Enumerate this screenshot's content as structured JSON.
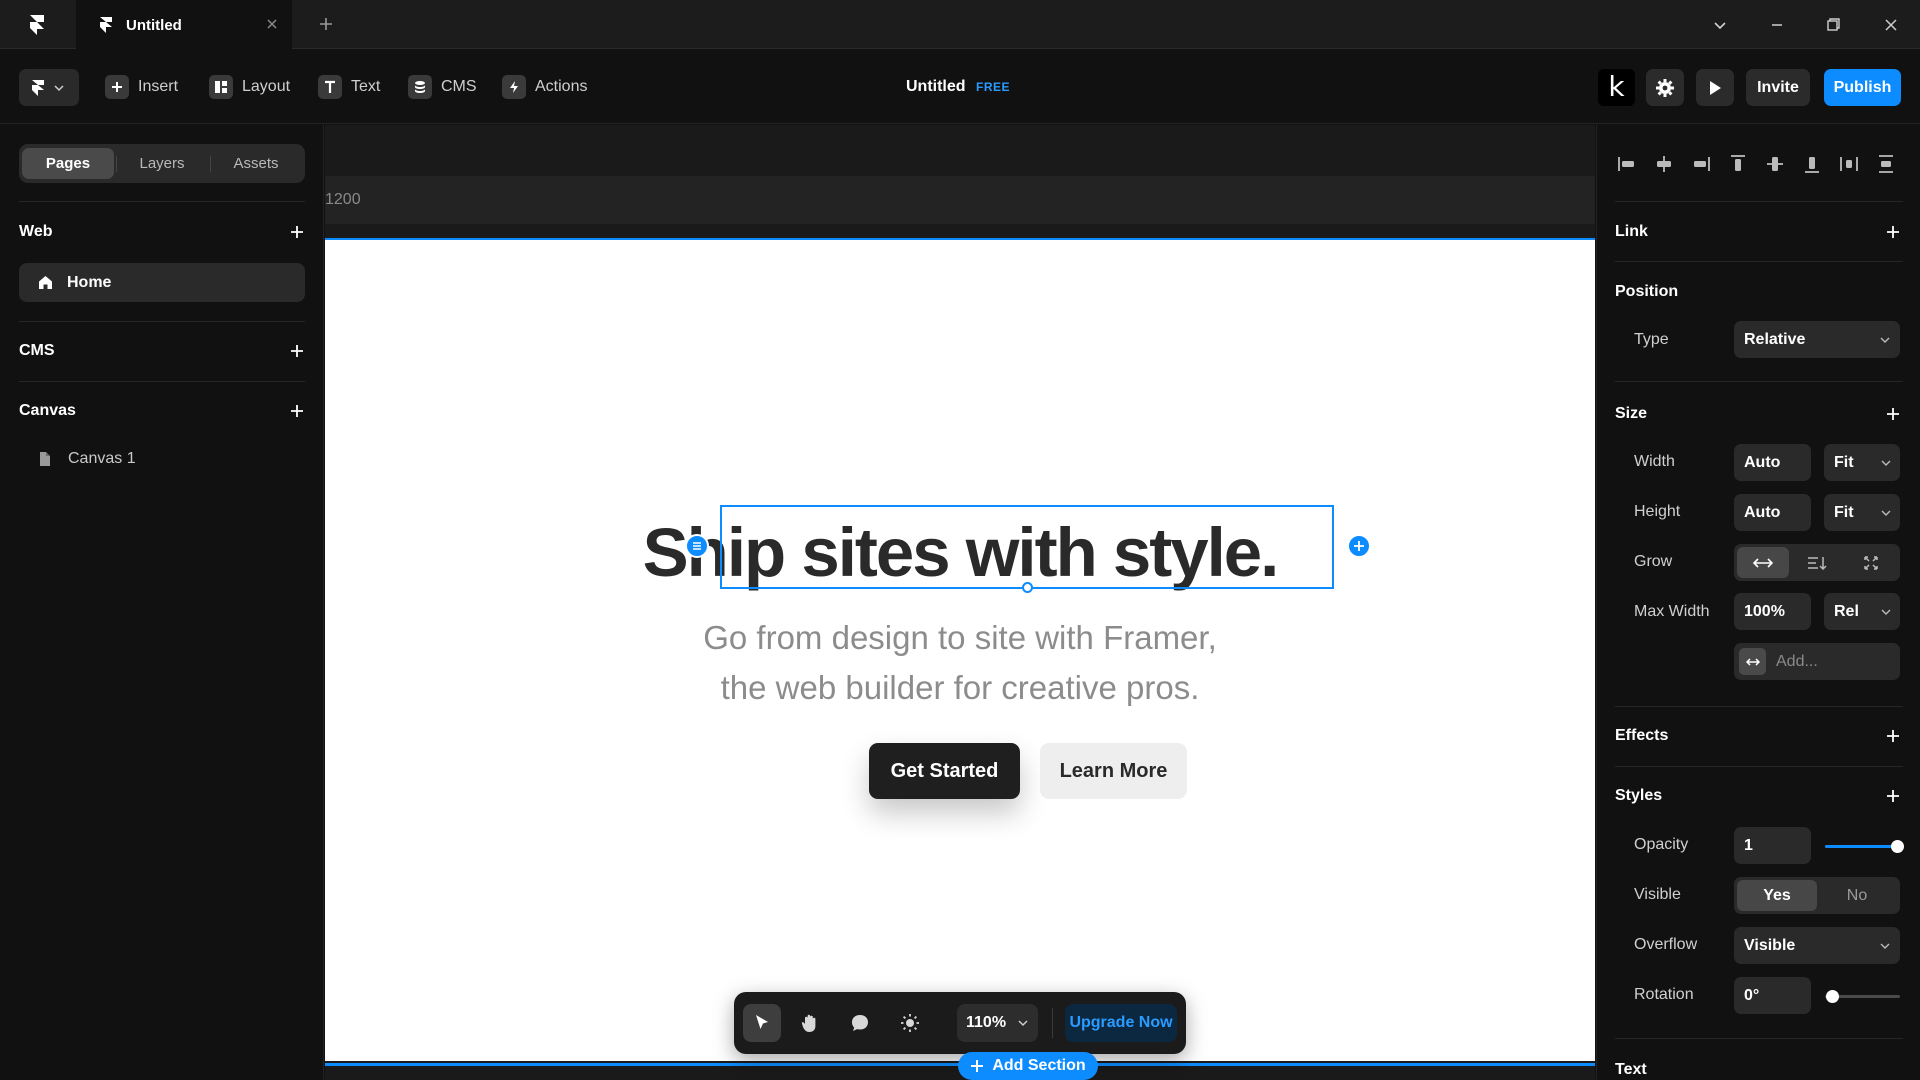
{
  "tab": {
    "title": "Untitled"
  },
  "toolbar": {
    "insert": "Insert",
    "layout": "Layout",
    "text": "Text",
    "cms": "CMS",
    "actions": "Actions",
    "doc_title": "Untitled",
    "plan_badge": "FREE",
    "k_label": "k",
    "invite": "Invite",
    "publish": "Publish"
  },
  "left_panel": {
    "tabs": [
      "Pages",
      "Layers",
      "Assets"
    ],
    "web_section": "Web",
    "home_page": "Home",
    "cms_section": "CMS",
    "canvas_section": "Canvas",
    "canvas_item": "Canvas 1"
  },
  "canvas": {
    "breakpoint_width": "1200",
    "headline": "Ship sites with style.",
    "subline_1": "Go from design to site with Framer,",
    "subline_2": "the web builder for creative pros.",
    "primary_cta": "Get Started",
    "secondary_cta": "Learn More",
    "zoom": "110%",
    "upgrade": "Upgrade Now",
    "add_section": "Add Section"
  },
  "right_panel": {
    "link": "Link",
    "position": "Position",
    "type_label": "Type",
    "type_value": "Relative",
    "size": "Size",
    "width_label": "Width",
    "width_value": "Auto",
    "width_mode": "Fit",
    "height_label": "Height",
    "height_value": "Auto",
    "height_mode": "Fit",
    "grow_label": "Grow",
    "max_width_label": "Max Width",
    "max_width_value": "100%",
    "max_width_mode": "Rel",
    "add_placeholder": "Add...",
    "effects": "Effects",
    "styles": "Styles",
    "opacity_label": "Opacity",
    "opacity_value": "1",
    "visible_label": "Visible",
    "visible_yes": "Yes",
    "visible_no": "No",
    "overflow_label": "Overflow",
    "overflow_value": "Visible",
    "rotation_label": "Rotation",
    "rotation_value": "0°",
    "text": "Text"
  },
  "colors": {
    "accent": "#0d8cff",
    "panel_bg": "#111111",
    "canvas_bg": "#1a1a1a",
    "headline": "#2a2a2a"
  },
  "icons": [
    "framer-logo-icon",
    "close-icon",
    "plus-icon",
    "chevron-down-icon",
    "minimize-icon",
    "maximize-icon",
    "settings-icon",
    "play-icon",
    "home-icon",
    "file-icon",
    "pointer-icon",
    "hand-icon",
    "comment-icon",
    "sun-icon"
  ]
}
